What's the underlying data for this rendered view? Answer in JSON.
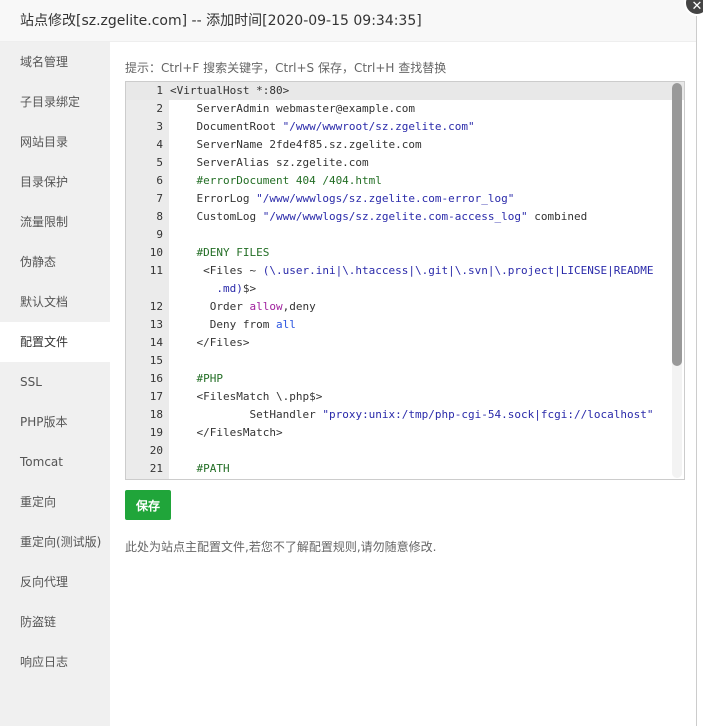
{
  "header": {
    "title": "站点修改[sz.zgelite.com] -- 添加时间[2020-09-15 09:34:35]",
    "close_icon": "close-icon"
  },
  "sidebar": {
    "items": [
      {
        "label": "域名管理"
      },
      {
        "label": "子目录绑定"
      },
      {
        "label": "网站目录"
      },
      {
        "label": "目录保护"
      },
      {
        "label": "流量限制"
      },
      {
        "label": "伪静态"
      },
      {
        "label": "默认文档"
      },
      {
        "label": "配置文件",
        "active": true
      },
      {
        "label": "SSL"
      },
      {
        "label": "PHP版本"
      },
      {
        "label": "Tomcat"
      },
      {
        "label": "重定向"
      },
      {
        "label": "重定向(测试版)"
      },
      {
        "label": "反向代理"
      },
      {
        "label": "防盗链"
      },
      {
        "label": "响应日志"
      }
    ]
  },
  "main": {
    "tip": "提示：Ctrl+F 搜索关键字，Ctrl+S 保存，Ctrl+H 查找替换",
    "editor": {
      "lines": [
        {
          "n": "1",
          "t": "<VirtualHost *:80>"
        },
        {
          "n": "2",
          "t": "    ServerAdmin webmaster@example.com"
        },
        {
          "n": "3",
          "t": "    DocumentRoot \"/www/wwwroot/sz.zgelite.com\""
        },
        {
          "n": "4",
          "t": "    ServerName 2fde4f85.sz.zgelite.com"
        },
        {
          "n": "5",
          "t": "    ServerAlias sz.zgelite.com"
        },
        {
          "n": "6",
          "t": "    #errorDocument 404 /404.html"
        },
        {
          "n": "7",
          "t": "    ErrorLog \"/www/wwwlogs/sz.zgelite.com-error_log\""
        },
        {
          "n": "8",
          "t": "    CustomLog \"/www/wwwlogs/sz.zgelite.com-access_log\" combined"
        },
        {
          "n": "9",
          "t": ""
        },
        {
          "n": "10",
          "t": "    #DENY FILES"
        },
        {
          "n": "11",
          "t": "     <Files ~ (\\.user.ini|\\.htaccess|\\.git|\\.svn|\\.project|LICENSE|README\n       .md)$>"
        },
        {
          "n": "12",
          "t": "      Order allow,deny"
        },
        {
          "n": "13",
          "t": "      Deny from all"
        },
        {
          "n": "14",
          "t": "    </Files>"
        },
        {
          "n": "15",
          "t": ""
        },
        {
          "n": "16",
          "t": "    #PHP"
        },
        {
          "n": "17",
          "t": "    <FilesMatch \\.php$>"
        },
        {
          "n": "18",
          "t": "            SetHandler \"proxy:unix:/tmp/php-cgi-54.sock|fcgi://localhost\""
        },
        {
          "n": "19",
          "t": "    </FilesMatch>"
        },
        {
          "n": "20",
          "t": ""
        },
        {
          "n": "21",
          "t": "    #PATH"
        }
      ]
    },
    "save_label": "保存",
    "note": "此处为站点主配置文件,若您不了解配置规则,请勿随意修改.",
    "accent": "#20a53a"
  }
}
